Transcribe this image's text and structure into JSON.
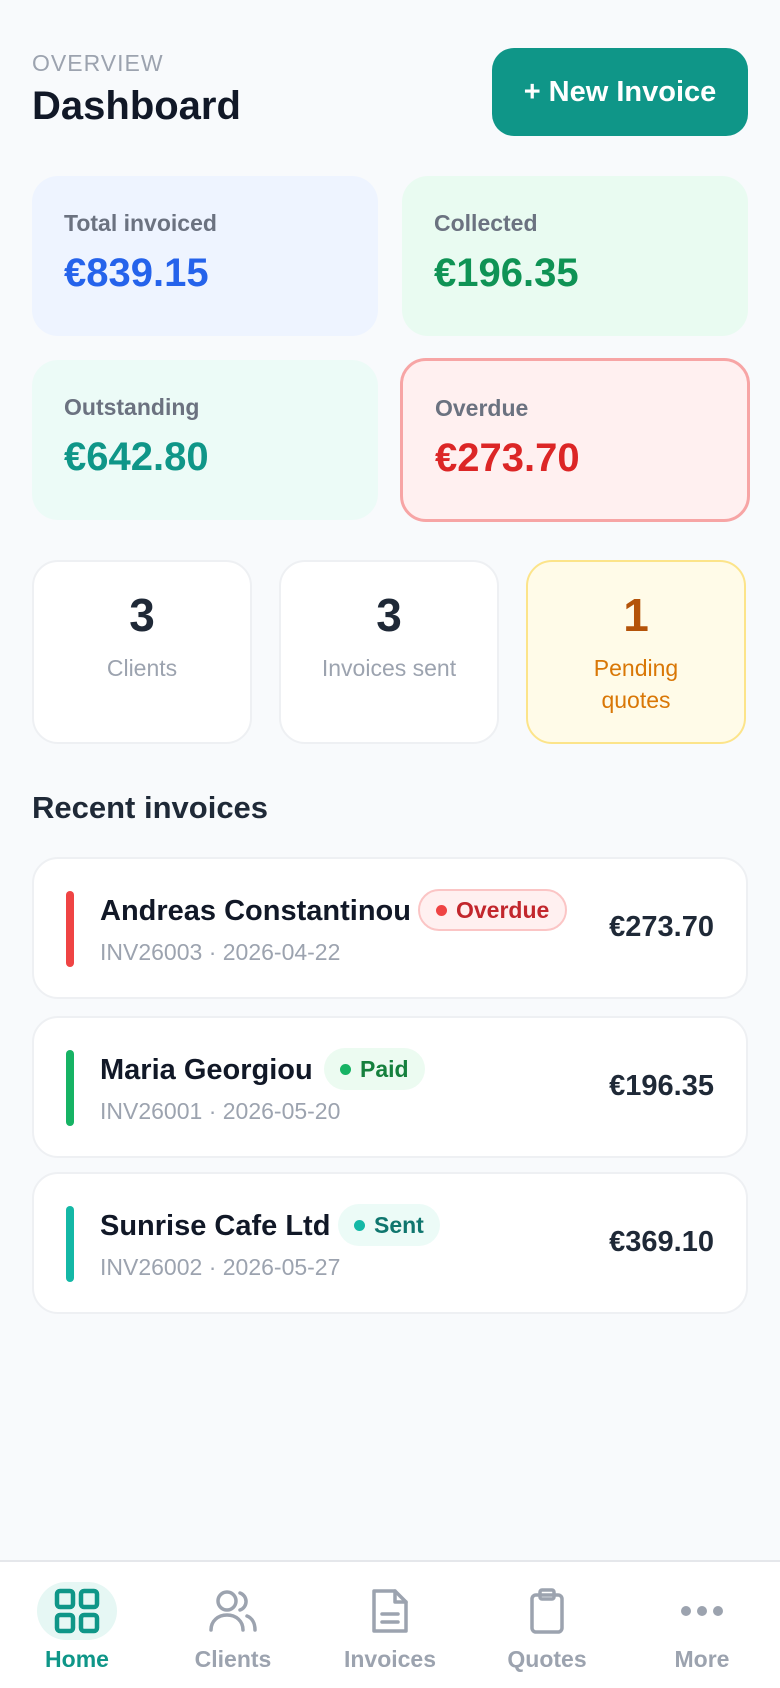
{
  "header": {
    "eyebrow": "OVERVIEW",
    "title": "Dashboard",
    "new_invoice_label": "+ New Invoice"
  },
  "stats": {
    "total_invoiced": {
      "label": "Total invoiced",
      "value": "€839.15"
    },
    "collected": {
      "label": "Collected",
      "value": "€196.35"
    },
    "outstanding": {
      "label": "Outstanding",
      "value": "€642.80"
    },
    "overdue": {
      "label": "Overdue",
      "value": "€273.70"
    }
  },
  "counts": {
    "clients": {
      "num": "3",
      "label": "Clients"
    },
    "invoices_sent": {
      "num": "3",
      "label": "Invoices sent"
    },
    "pending_quotes": {
      "num": "1",
      "label": "Pending quotes"
    }
  },
  "recent": {
    "title": "Recent invoices",
    "invoices": [
      {
        "client": "Andreas Constantinou",
        "status": "Overdue",
        "meta": "INV26003 · 2026-04-22",
        "amount": "€273.70",
        "color": "#ef4444"
      },
      {
        "client": "Maria Georgiou",
        "status": "Paid",
        "meta": "INV26001 · 2026-05-20",
        "amount": "€196.35",
        "color": "#16b364"
      },
      {
        "client": "Sunrise Cafe Ltd",
        "status": "Sent",
        "meta": "INV26002 · 2026-05-27",
        "amount": "€369.10",
        "color": "#14b8a6"
      }
    ]
  },
  "nav": {
    "items": [
      {
        "label": "Home",
        "icon": "grid-icon",
        "active": true
      },
      {
        "label": "Clients",
        "icon": "users-icon"
      },
      {
        "label": "Invoices",
        "icon": "document-icon"
      },
      {
        "label": "Quotes",
        "icon": "clipboard-icon"
      },
      {
        "label": "More",
        "icon": "more-icon"
      }
    ]
  },
  "colors": {
    "accent": "#0f9688",
    "blue": "#2563eb",
    "green": "#0f9355",
    "red": "#dc2626",
    "amber": "#b45309"
  }
}
